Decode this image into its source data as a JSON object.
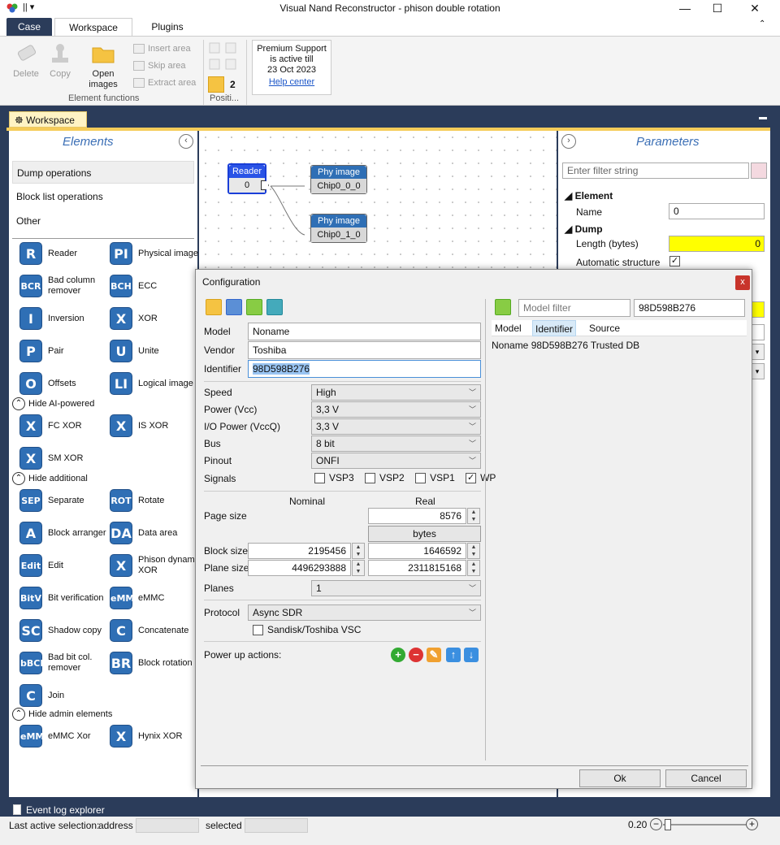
{
  "window": {
    "title": "Visual Nand Reconstructor - phison double rotation"
  },
  "ribbon": {
    "tabs": [
      "Case",
      "Workspace",
      "Plugins"
    ],
    "delete": "Delete",
    "copy": "Copy",
    "open_images": "Open\nimages",
    "insert_area": "Insert area",
    "skip_area": "Skip area",
    "extract_area": "Extract area",
    "group_label": "Element functions",
    "position_label": "Positi...",
    "position_value": "2",
    "premium_line1": "Premium Support",
    "premium_line2": "is active till",
    "premium_date": "23 Oct 2023",
    "help_center": "Help center"
  },
  "workspace_tab": "Workspace",
  "elements": {
    "title": "Elements",
    "categories": [
      "Dump operations",
      "Block list operations",
      "Other"
    ],
    "items": [
      {
        "badge": "R",
        "label": "Reader"
      },
      {
        "badge": "PI",
        "label": "Physical image"
      },
      {
        "badge": "BCR",
        "label": "Bad column remover"
      },
      {
        "badge": "BCH",
        "label": "ECC"
      },
      {
        "badge": "I",
        "label": "Inversion"
      },
      {
        "badge": "X",
        "label": "XOR"
      },
      {
        "badge": "P",
        "label": "Pair"
      },
      {
        "badge": "U",
        "label": "Unite"
      },
      {
        "badge": "O",
        "label": "Offsets"
      },
      {
        "badge": "LI",
        "label": "Logical image"
      }
    ],
    "hide_ai": "Hide AI-powered",
    "ai_items": [
      {
        "badge": "X",
        "label": "FC XOR"
      },
      {
        "badge": "X",
        "label": "IS XOR"
      },
      {
        "badge": "X",
        "label": "SM XOR"
      }
    ],
    "hide_additional": "Hide additional",
    "additional_items": [
      {
        "badge": "SEP",
        "label": "Separate"
      },
      {
        "badge": "ROT",
        "label": "Rotate"
      },
      {
        "badge": "A",
        "label": "Block arranger"
      },
      {
        "badge": "DA",
        "label": "Data area"
      },
      {
        "badge": "Edit",
        "label": "Edit"
      },
      {
        "badge": "X",
        "label": "Phison dynamic XOR"
      },
      {
        "badge": "BitV",
        "label": "Bit verification"
      },
      {
        "badge": "eMMC",
        "label": "eMMC"
      },
      {
        "badge": "SC",
        "label": "Shadow copy"
      },
      {
        "badge": "C",
        "label": "Concatenate"
      },
      {
        "badge": "bBCR",
        "label": "Bad bit col. remover"
      },
      {
        "badge": "BR",
        "label": "Block rotation"
      },
      {
        "badge": "C",
        "label": "Join"
      }
    ],
    "hide_admin": "Hide admin elements",
    "admin_items": [
      {
        "badge": "eMMC XS",
        "label": "eMMC Xor"
      },
      {
        "badge": "X",
        "label": "Hynix XOR"
      }
    ]
  },
  "canvas": {
    "reader": {
      "title": "Reader",
      "value": "0"
    },
    "phy1": {
      "title": "Phy image",
      "value": "Chip0_0_0"
    },
    "phy2": {
      "title": "Phy image",
      "value": "Chip0_1_0"
    }
  },
  "parameters": {
    "title": "Parameters",
    "filter_placeholder": "Enter filter string",
    "section_element": "Element",
    "name_label": "Name",
    "name_value": "0",
    "section_dump": "Dump",
    "length_label": "Length (bytes)",
    "length_value": "0",
    "auto_structure": "Automatic structure"
  },
  "dialog": {
    "title": "Configuration",
    "close": "x",
    "model_label": "Model",
    "model_value": "Noname",
    "vendor_label": "Vendor",
    "vendor_value": "Toshiba",
    "identifier_label": "Identifier",
    "identifier_value": "98D598B276",
    "speed_label": "Speed",
    "speed_value": "High",
    "power_label": "Power (Vcc)",
    "power_value": "3,3 V",
    "io_power_label": "I/O Power (VccQ)",
    "io_power_value": "3,3 V",
    "bus_label": "Bus",
    "bus_value": "8 bit",
    "pinout_label": "Pinout",
    "pinout_value": "ONFI",
    "signals_label": "Signals",
    "signals": [
      {
        "name": "VSP3",
        "checked": false
      },
      {
        "name": "VSP2",
        "checked": false
      },
      {
        "name": "VSP1",
        "checked": false
      },
      {
        "name": "WP",
        "checked": true
      }
    ],
    "nominal": "Nominal",
    "real": "Real",
    "page_size_label": "Page size",
    "page_size_real": "8576",
    "bytes_label": "bytes",
    "block_size_label": "Block size",
    "block_size_nominal": "2195456",
    "block_size_real": "1646592",
    "plane_size_label": "Plane size",
    "plane_size_nominal": "4496293888",
    "plane_size_real": "2311815168",
    "planes_label": "Planes",
    "planes_value": "1",
    "protocol_label": "Protocol",
    "protocol_value": "Async SDR",
    "vsc_label": "Sandisk/Toshiba VSC",
    "power_up_label": "Power up actions:",
    "model_filter_placeholder": "Model filter",
    "model_filter_id": "98D598B276",
    "table_headers": [
      "Model",
      "Identifier",
      "Source"
    ],
    "table_rows": [
      [
        "Noname",
        "98D598B276",
        "Trusted DB"
      ]
    ],
    "ok": "Ok",
    "cancel": "Cancel"
  },
  "event_log": "Event log explorer",
  "status": {
    "last_selection": "Last active selection:",
    "address": "address",
    "selected": "selected",
    "zoom": "0.20"
  },
  "colors": {
    "frame": "#2b3c5a",
    "accent_blue": "#2f6fb5",
    "highlight_yellow": "#ffff00",
    "workspace_tab": "#f5cc5a"
  }
}
